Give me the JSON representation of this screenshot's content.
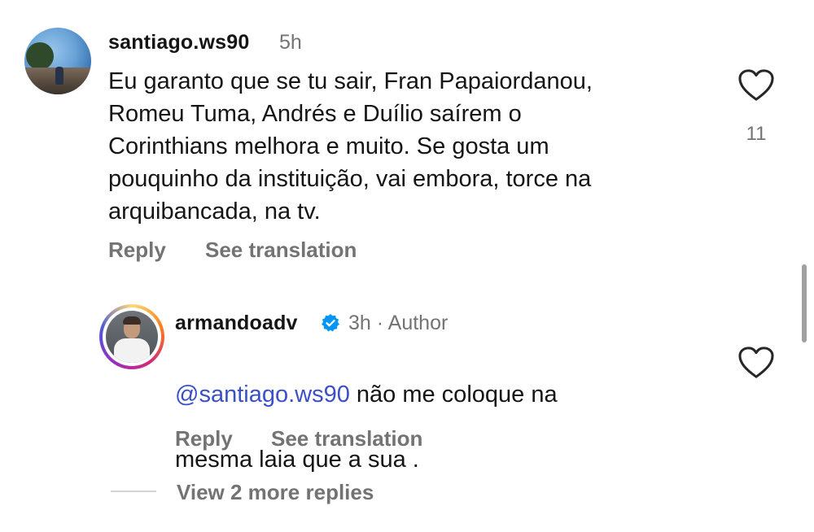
{
  "comment": {
    "username": "santiago.ws90",
    "time": "5h",
    "text": "Eu garanto que se tu sair, Fran Papaiordanou,\nRomeu Tuma, Andrés e Duílio saírem o\nCorinthians melhora e muito. Se gosta um\npouquinho da instituição, vai embora, torce na\narquibancada, na tv.",
    "like_count": "11",
    "reply_label": "Reply",
    "translate_label": "See translation"
  },
  "reply": {
    "username": "armandoadv",
    "meta": "3h · Author",
    "mention": "@santiago.ws90",
    "text_line1": " não me coloque na",
    "text_line2": "mesma laia que a sua .",
    "reply_label": "Reply",
    "translate_label": "See translation"
  },
  "view_more_label": "View 2 more replies",
  "icons": {
    "like": "heart-outline-icon",
    "verified": "verified-badge-icon"
  },
  "colors": {
    "mention": "#3b4fc7",
    "verified": "#0095f6",
    "secondary_text": "#737373"
  }
}
